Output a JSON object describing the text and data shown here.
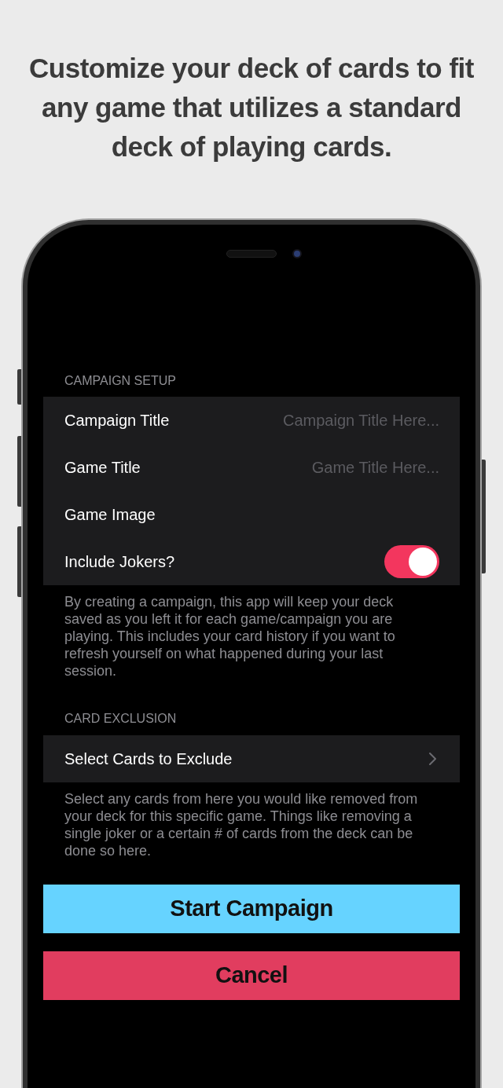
{
  "headline": "Customize your deck of cards to fit any game that utilizes a standard deck of playing cards.",
  "sections": [
    {
      "header": "CAMPAIGN SETUP",
      "rows": [
        {
          "kind": "text_field",
          "label": "Campaign Title",
          "placeholder": "Campaign Title Here..."
        },
        {
          "kind": "text_field",
          "label": "Game Title",
          "placeholder": "Game Title Here..."
        },
        {
          "kind": "picker",
          "label": "Game Image"
        },
        {
          "kind": "toggle",
          "label": "Include Jokers?",
          "on": true
        }
      ],
      "footer": "By creating a campaign, this app will keep your deck saved as you left it for each game/campaign you are playing. This includes your card history if you want to refresh yourself on what happened during your last session."
    },
    {
      "header": "CARD EXCLUSION",
      "rows": [
        {
          "kind": "link",
          "label": "Select Cards to Exclude"
        }
      ],
      "footer": "Select any cards from here you would like removed from your deck for this specific game. Things like removing a single joker or a certain # of cards from the deck can be done so here."
    }
  ],
  "buttons": [
    {
      "kind": "primary",
      "label": "Start Campaign"
    },
    {
      "kind": "destructive",
      "label": "Cancel"
    }
  ]
}
